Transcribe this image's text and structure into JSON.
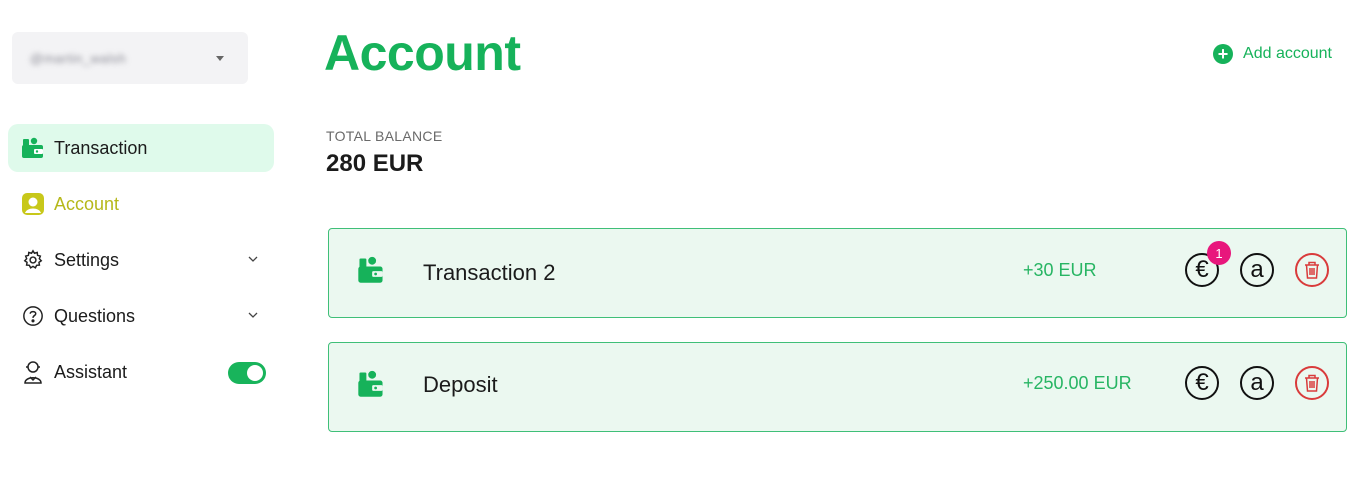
{
  "user": {
    "name": "@martin_walsh",
    "icon": "chevron-down-icon"
  },
  "nav": {
    "items": [
      {
        "label": "Transaction",
        "icon": "wallet-icon",
        "active": true
      },
      {
        "label": "Account",
        "icon": "account-icon"
      },
      {
        "label": "Settings",
        "icon": "gear-icon",
        "expandable": true
      },
      {
        "label": "Questions",
        "icon": "question-icon",
        "expandable": true
      },
      {
        "label": "Assistant",
        "icon": "assistant-icon",
        "toggle_on": true
      }
    ]
  },
  "main": {
    "title": "Account",
    "add_account_label": "Add account",
    "balance_label": "TOTAL BALANCE",
    "balance_value": "280 EUR"
  },
  "transactions": [
    {
      "title": "Transaction 2",
      "amount": "+30 EUR",
      "badge": "1"
    },
    {
      "title": "Deposit",
      "amount": "+250.00 EUR",
      "badge": ""
    }
  ],
  "actions": {
    "euro_symbol": "€",
    "a_symbol": "a"
  },
  "colors": {
    "brand_green": "#16b25a",
    "account_yellow": "#b6b81a",
    "badge_pink": "#e8177c",
    "delete_red": "#d93b3b"
  }
}
